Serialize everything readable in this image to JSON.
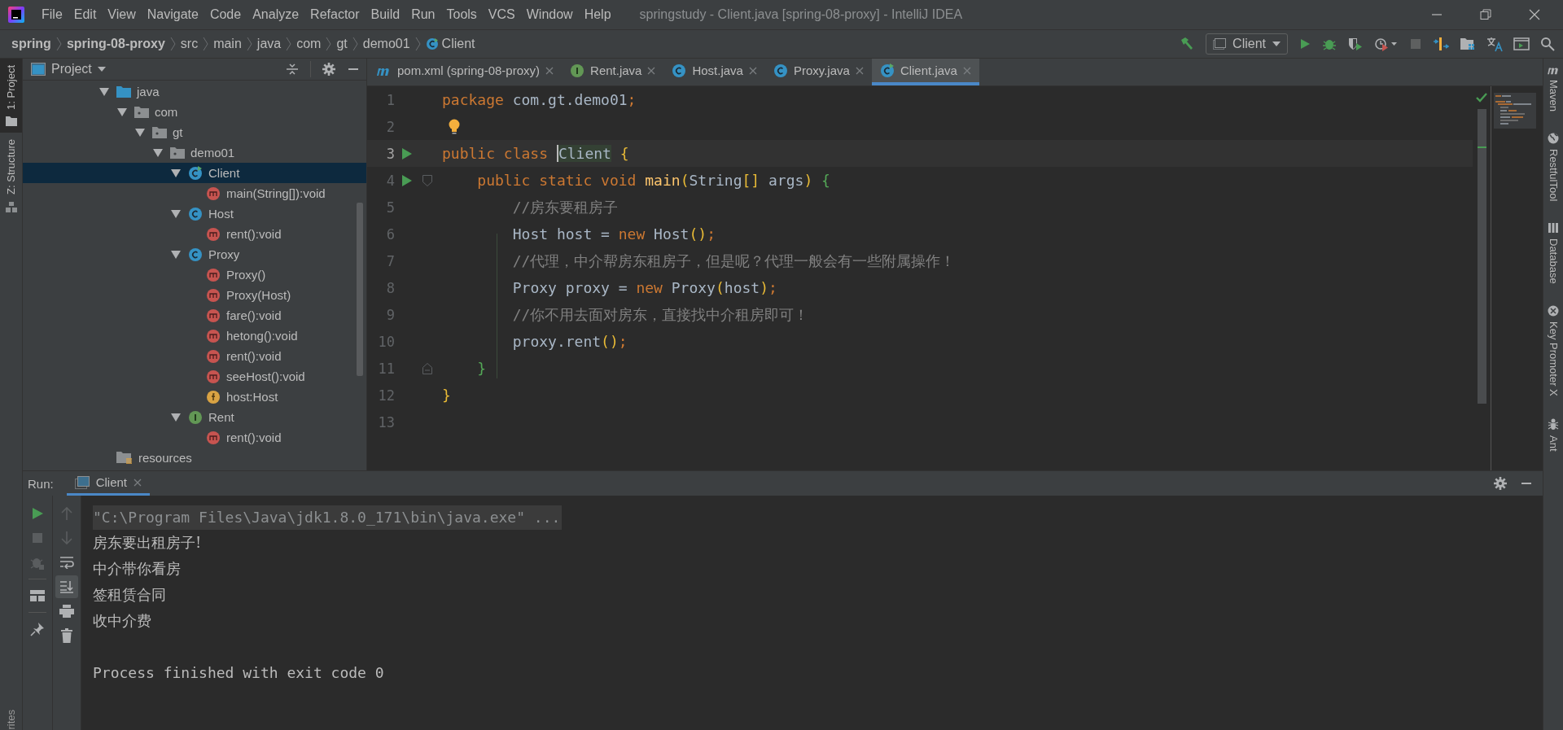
{
  "window": {
    "title": "springstudy - Client.java [spring-08-proxy] - IntelliJ IDEA"
  },
  "menu": [
    "File",
    "Edit",
    "View",
    "Navigate",
    "Code",
    "Analyze",
    "Refactor",
    "Build",
    "Run",
    "Tools",
    "VCS",
    "Window",
    "Help"
  ],
  "breadcrumbs": [
    {
      "label": "spring",
      "kind": "module"
    },
    {
      "label": "spring-08-proxy",
      "kind": "module"
    },
    {
      "label": "src",
      "kind": "folder"
    },
    {
      "label": "main",
      "kind": "folder"
    },
    {
      "label": "java",
      "kind": "folder"
    },
    {
      "label": "com",
      "kind": "folder"
    },
    {
      "label": "gt",
      "kind": "folder"
    },
    {
      "label": "demo01",
      "kind": "folder"
    },
    {
      "label": "Client",
      "kind": "class"
    }
  ],
  "toolbar": {
    "run_config": "Client"
  },
  "left_strip": [
    {
      "label": "1: Project",
      "selected": true
    },
    {
      "label": "Z: Structure",
      "selected": false
    }
  ],
  "favorites_label": "rites",
  "project_panel": {
    "title": "Project",
    "tree": [
      {
        "label": "java",
        "kind": "source-folder",
        "selected": false,
        "expanded": true,
        "children": [
          {
            "label": "com",
            "kind": "package",
            "selected": false,
            "expanded": true,
            "children": [
              {
                "label": "gt",
                "kind": "package",
                "selected": false,
                "expanded": true,
                "children": [
                  {
                    "label": "demo01",
                    "kind": "package",
                    "selected": false,
                    "expanded": true,
                    "children": [
                      {
                        "label": "Client",
                        "kind": "runnable-class",
                        "selected": true,
                        "expanded": true,
                        "children": [
                          {
                            "label": "main(String[]):void",
                            "kind": "method",
                            "selected": false
                          }
                        ]
                      },
                      {
                        "label": "Host",
                        "kind": "class",
                        "selected": false,
                        "expanded": true,
                        "children": [
                          {
                            "label": "rent():void",
                            "kind": "method",
                            "selected": false
                          }
                        ]
                      },
                      {
                        "label": "Proxy",
                        "kind": "class",
                        "selected": false,
                        "expanded": true,
                        "children": [
                          {
                            "label": "Proxy()",
                            "kind": "method",
                            "selected": false
                          },
                          {
                            "label": "Proxy(Host)",
                            "kind": "method",
                            "selected": false
                          },
                          {
                            "label": "fare():void",
                            "kind": "method",
                            "selected": false
                          },
                          {
                            "label": "hetong():void",
                            "kind": "method",
                            "selected": false
                          },
                          {
                            "label": "rent():void",
                            "kind": "method",
                            "selected": false
                          },
                          {
                            "label": "seeHost():void",
                            "kind": "method",
                            "selected": false
                          },
                          {
                            "label": "host:Host",
                            "kind": "field",
                            "selected": false
                          }
                        ]
                      },
                      {
                        "label": "Rent",
                        "kind": "interface",
                        "selected": false,
                        "expanded": true,
                        "children": [
                          {
                            "label": "rent():void",
                            "kind": "method",
                            "selected": false
                          }
                        ]
                      }
                    ]
                  }
                ]
              }
            ]
          }
        ]
      },
      {
        "label": "resources",
        "kind": "resources-folder",
        "selected": false
      }
    ]
  },
  "editor": {
    "tabs": [
      {
        "label": "pom.xml (spring-08-proxy)",
        "kind": "maven",
        "selected": false
      },
      {
        "label": "Rent.java",
        "kind": "interface",
        "selected": false
      },
      {
        "label": "Host.java",
        "kind": "class",
        "selected": false
      },
      {
        "label": "Proxy.java",
        "kind": "class",
        "selected": false
      },
      {
        "label": "Client.java",
        "kind": "runnable-class",
        "selected": true
      }
    ],
    "lines": [
      {
        "number": "1",
        "kind": "plain",
        "current": false,
        "run_marker": false,
        "intention_bulb": false,
        "tokens": [
          {
            "kind": "keyword",
            "text": "package"
          },
          {
            "kind": "plain",
            "text": " com.gt.demo01"
          },
          {
            "kind": "keyword",
            "text": ";"
          }
        ]
      },
      {
        "number": "2",
        "kind": "plain",
        "current": false,
        "run_marker": false,
        "intention_bulb": true
      },
      {
        "number": "3",
        "kind": "plain",
        "current": true,
        "run_marker": true,
        "intention_bulb": false,
        "tokens": [
          {
            "kind": "keyword",
            "text": "public class "
          },
          {
            "kind": "caret-identifier",
            "text": "Client"
          },
          {
            "kind": "bracket",
            "text": " {"
          }
        ]
      },
      {
        "number": "4",
        "kind": "fold-start",
        "current": false,
        "run_marker": true,
        "intention_bulb": false,
        "tokens": [
          {
            "kind": "keyword",
            "text": "    public static void "
          },
          {
            "kind": "method",
            "text": "main"
          },
          {
            "kind": "bracket",
            "text": "("
          },
          {
            "kind": "plain",
            "text": "String"
          },
          {
            "kind": "bracket",
            "text": "[]"
          },
          {
            "kind": "plain",
            "text": " args"
          },
          {
            "kind": "bracket",
            "text": ")"
          },
          {
            "kind": "bracket-inner",
            "text": " {"
          }
        ]
      },
      {
        "number": "5",
        "kind": "plain",
        "current": false,
        "run_marker": false,
        "intention_bulb": false,
        "tokens": [
          {
            "kind": "comment",
            "text": "        //房东要租房子"
          }
        ]
      },
      {
        "number": "6",
        "kind": "plain",
        "current": false,
        "run_marker": false,
        "intention_bulb": false,
        "tokens": [
          {
            "kind": "plain",
            "text": "        Host host = "
          },
          {
            "kind": "keyword",
            "text": "new"
          },
          {
            "kind": "plain",
            "text": " Host"
          },
          {
            "kind": "bracket",
            "text": "()"
          },
          {
            "kind": "keyword",
            "text": ";"
          }
        ]
      },
      {
        "number": "7",
        "kind": "plain",
        "current": false,
        "run_marker": false,
        "intention_bulb": false,
        "tokens": [
          {
            "kind": "comment",
            "text": "        //代理，中介帮房东租房子，但是呢？代理一般会有一些附属操作！"
          }
        ]
      },
      {
        "number": "8",
        "kind": "plain",
        "current": false,
        "run_marker": false,
        "intention_bulb": false,
        "tokens": [
          {
            "kind": "plain",
            "text": "        Proxy proxy = "
          },
          {
            "kind": "keyword",
            "text": "new"
          },
          {
            "kind": "plain",
            "text": " Proxy"
          },
          {
            "kind": "bracket",
            "text": "("
          },
          {
            "kind": "plain",
            "text": "host"
          },
          {
            "kind": "bracket",
            "text": ")"
          },
          {
            "kind": "keyword",
            "text": ";"
          }
        ]
      },
      {
        "number": "9",
        "kind": "plain",
        "current": false,
        "run_marker": false,
        "intention_bulb": false,
        "tokens": [
          {
            "kind": "comment",
            "text": "        //你不用去面对房东，直接找中介租房即可！"
          }
        ]
      },
      {
        "number": "10",
        "kind": "plain",
        "current": false,
        "run_marker": false,
        "intention_bulb": false,
        "tokens": [
          {
            "kind": "plain",
            "text": "        proxy.rent"
          },
          {
            "kind": "bracket",
            "text": "()"
          },
          {
            "kind": "keyword",
            "text": ";"
          }
        ]
      },
      {
        "number": "11",
        "kind": "fold-end",
        "current": false,
        "run_marker": false,
        "intention_bulb": false,
        "tokens": [
          {
            "kind": "bracket-inner",
            "text": "    }"
          }
        ]
      },
      {
        "number": "12",
        "kind": "plain",
        "current": false,
        "run_marker": false,
        "intention_bulb": false,
        "tokens": [
          {
            "kind": "bracket",
            "text": "}"
          }
        ]
      },
      {
        "number": "13",
        "kind": "plain",
        "current": false,
        "run_marker": false,
        "intention_bulb": false
      }
    ]
  },
  "right_strip": [
    {
      "label": "Maven",
      "kind": "maven"
    },
    {
      "label": "RestfulTool",
      "kind": "globe"
    },
    {
      "label": "Database",
      "kind": "database"
    },
    {
      "label": "Key Promoter X",
      "kind": "key"
    },
    {
      "label": "Ant",
      "kind": "ant"
    }
  ],
  "run_panel": {
    "label": "Run:",
    "tabs": [
      {
        "label": "Client",
        "selected": true
      }
    ],
    "left_tools": [
      {
        "kind": "run",
        "disabled": false
      },
      {
        "kind": "stop",
        "disabled": true
      },
      {
        "kind": "debug",
        "disabled": true
      },
      {
        "kind": "layout",
        "disabled": false
      },
      {
        "kind": "pin",
        "disabled": false
      }
    ],
    "right_tools": [
      {
        "kind": "up",
        "disabled": true,
        "on": false
      },
      {
        "kind": "down",
        "disabled": true,
        "on": false
      },
      {
        "kind": "wrap",
        "disabled": false,
        "on": false
      },
      {
        "kind": "scroll-end",
        "disabled": false,
        "on": true
      },
      {
        "kind": "print",
        "disabled": false,
        "on": false
      },
      {
        "kind": "trash",
        "disabled": false,
        "on": false
      }
    ],
    "command": "\"C:\\Program Files\\Java\\jdk1.8.0_171\\bin\\java.exe\" ...",
    "output": [
      "房东要出租房子!",
      "中介带你看房",
      "签租赁合同",
      "收中介费"
    ],
    "exit_message": "Process finished with exit code 0"
  }
}
